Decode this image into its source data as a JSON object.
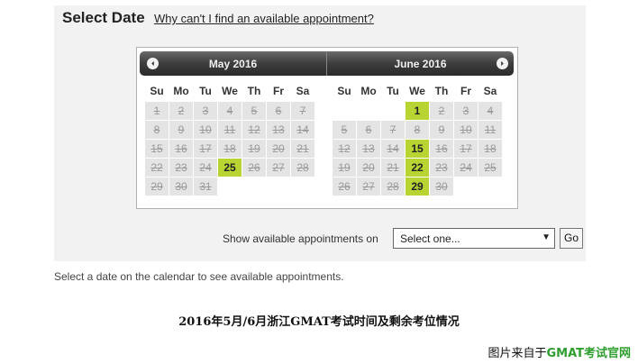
{
  "header": {
    "title": "Select Date",
    "help_link": "Why can't I find an available appointment?"
  },
  "calendar": {
    "months": [
      {
        "label": "May 2016",
        "weekdays": [
          "Su",
          "Mo",
          "Tu",
          "We",
          "Th",
          "Fr",
          "Sa"
        ],
        "weeks": [
          [
            {
              "d": "1",
              "s": "unavail"
            },
            {
              "d": "2",
              "s": "unavail"
            },
            {
              "d": "3",
              "s": "unavail"
            },
            {
              "d": "4",
              "s": "unavail"
            },
            {
              "d": "5",
              "s": "unavail"
            },
            {
              "d": "6",
              "s": "unavail"
            },
            {
              "d": "7",
              "s": "unavail"
            }
          ],
          [
            {
              "d": "8",
              "s": "unavail"
            },
            {
              "d": "9",
              "s": "unavail"
            },
            {
              "d": "10",
              "s": "unavail"
            },
            {
              "d": "11",
              "s": "unavail"
            },
            {
              "d": "12",
              "s": "unavail"
            },
            {
              "d": "13",
              "s": "unavail"
            },
            {
              "d": "14",
              "s": "unavail"
            }
          ],
          [
            {
              "d": "15",
              "s": "unavail"
            },
            {
              "d": "16",
              "s": "unavail"
            },
            {
              "d": "17",
              "s": "unavail"
            },
            {
              "d": "18",
              "s": "unavail"
            },
            {
              "d": "19",
              "s": "unavail"
            },
            {
              "d": "20",
              "s": "unavail"
            },
            {
              "d": "21",
              "s": "unavail"
            }
          ],
          [
            {
              "d": "22",
              "s": "unavail"
            },
            {
              "d": "23",
              "s": "unavail"
            },
            {
              "d": "24",
              "s": "unavail"
            },
            {
              "d": "25",
              "s": "avail"
            },
            {
              "d": "26",
              "s": "unavail"
            },
            {
              "d": "27",
              "s": "unavail"
            },
            {
              "d": "28",
              "s": "unavail"
            }
          ],
          [
            {
              "d": "29",
              "s": "unavail"
            },
            {
              "d": "30",
              "s": "unavail"
            },
            {
              "d": "31",
              "s": "unavail"
            },
            {
              "d": "",
              "s": "empty"
            },
            {
              "d": "",
              "s": "empty"
            },
            {
              "d": "",
              "s": "empty"
            },
            {
              "d": "",
              "s": "empty"
            }
          ]
        ]
      },
      {
        "label": "June 2016",
        "weekdays": [
          "Su",
          "Mo",
          "Tu",
          "We",
          "Th",
          "Fr",
          "Sa"
        ],
        "weeks": [
          [
            {
              "d": "",
              "s": "empty"
            },
            {
              "d": "",
              "s": "empty"
            },
            {
              "d": "",
              "s": "empty"
            },
            {
              "d": "1",
              "s": "avail"
            },
            {
              "d": "2",
              "s": "unavail"
            },
            {
              "d": "3",
              "s": "unavail"
            },
            {
              "d": "4",
              "s": "unavail"
            }
          ],
          [
            {
              "d": "5",
              "s": "unavail"
            },
            {
              "d": "6",
              "s": "unavail"
            },
            {
              "d": "7",
              "s": "unavail"
            },
            {
              "d": "8",
              "s": "unavail"
            },
            {
              "d": "9",
              "s": "unavail"
            },
            {
              "d": "10",
              "s": "unavail"
            },
            {
              "d": "11",
              "s": "unavail"
            }
          ],
          [
            {
              "d": "12",
              "s": "unavail"
            },
            {
              "d": "13",
              "s": "unavail"
            },
            {
              "d": "14",
              "s": "unavail"
            },
            {
              "d": "15",
              "s": "avail"
            },
            {
              "d": "16",
              "s": "unavail"
            },
            {
              "d": "17",
              "s": "unavail"
            },
            {
              "d": "18",
              "s": "unavail"
            }
          ],
          [
            {
              "d": "19",
              "s": "unavail"
            },
            {
              "d": "20",
              "s": "unavail"
            },
            {
              "d": "21",
              "s": "unavail"
            },
            {
              "d": "22",
              "s": "avail"
            },
            {
              "d": "23",
              "s": "unavail"
            },
            {
              "d": "24",
              "s": "unavail"
            },
            {
              "d": "25",
              "s": "unavail"
            }
          ],
          [
            {
              "d": "26",
              "s": "unavail"
            },
            {
              "d": "27",
              "s": "unavail"
            },
            {
              "d": "28",
              "s": "unavail"
            },
            {
              "d": "29",
              "s": "avail"
            },
            {
              "d": "30",
              "s": "unavail"
            },
            {
              "d": "",
              "s": "empty"
            },
            {
              "d": "",
              "s": "empty"
            }
          ]
        ]
      }
    ],
    "nav_prev_icon": "chevron-left-icon",
    "nav_next_icon": "chevron-right-icon",
    "colors": {
      "available": "#b7d433",
      "unavailable": "#e4e4e4",
      "header": "#3d3d3d"
    }
  },
  "appointments": {
    "label": "Show available appointments on",
    "select_value": "Select one...",
    "go_label": "Go"
  },
  "hint": "Select a date on the calendar to see available appointments.",
  "caption": "2016年5月/6月浙江GMAT考试时间及剩余考位情况",
  "credit": {
    "prefix": "图片来自于",
    "brand": "GMAT考试官网"
  }
}
